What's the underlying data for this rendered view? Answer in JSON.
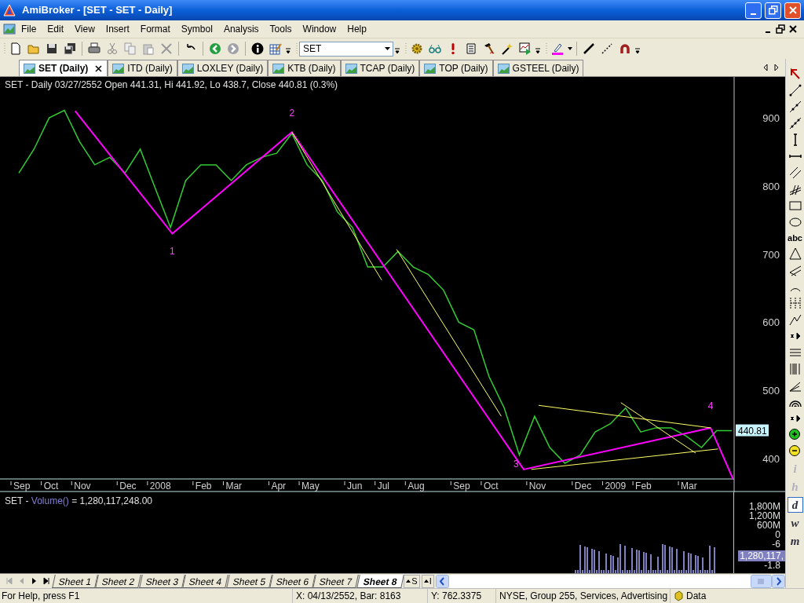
{
  "window": {
    "title": "AmiBroker - [SET - SET - Daily]"
  },
  "menu": [
    "File",
    "Edit",
    "View",
    "Insert",
    "Format",
    "Symbol",
    "Analysis",
    "Tools",
    "Window",
    "Help"
  ],
  "toolbar": {
    "symbol": "SET"
  },
  "chart_tabs": [
    {
      "label": "SET (Daily)",
      "selected": true
    },
    {
      "label": "ITD (Daily)",
      "selected": false
    },
    {
      "label": "LOXLEY (Daily)",
      "selected": false
    },
    {
      "label": "KTB (Daily)",
      "selected": false
    },
    {
      "label": "TCAP (Daily)",
      "selected": false
    },
    {
      "label": "TOP (Daily)",
      "selected": false
    },
    {
      "label": "GSTEEL (Daily)",
      "selected": false
    }
  ],
  "price_pane": {
    "header": "SET - Daily 03/27/2552 Open 441.31, Hi 441.92, Lo 438.7, Close 440.81 (0.3%)",
    "last_price": "440.81",
    "chart_data": {
      "type": "line",
      "categories": [
        "Sep",
        null,
        "Oct",
        null,
        "Nov",
        null,
        null,
        "Dec",
        null,
        "2008",
        null,
        null,
        "Feb",
        null,
        "Mar",
        null,
        null,
        "Apr",
        null,
        "May",
        null,
        null,
        "Jun",
        null,
        "Jul",
        null,
        "Aug",
        null,
        null,
        "Sep",
        null,
        "Oct",
        null,
        null,
        "Nov",
        null,
        null,
        "Dec",
        null,
        "2009",
        null,
        "Feb",
        null,
        null,
        "Mar",
        null,
        null,
        null
      ],
      "ylim": [
        370,
        960
      ],
      "yticks": [
        400,
        500,
        600,
        700,
        800,
        900
      ],
      "series": [
        {
          "color": "#33cc33",
          "values": [
            819,
            854,
            900,
            911,
            865,
            831,
            842,
            819,
            854,
            796,
            739,
            808,
            831,
            831,
            808,
            831,
            842,
            848,
            877,
            831,
            808,
            762,
            739,
            681,
            681,
            704,
            681,
            670,
            647,
            600,
            589,
            520,
            474,
            405,
            462,
            416,
            393,
            405,
            439,
            451,
            474,
            439,
            445,
            445,
            433,
            416,
            441,
            441
          ]
        }
      ]
    },
    "wave_labels": [
      "1",
      "2",
      "3",
      "4"
    ]
  },
  "volume_pane": {
    "symbol": "SET - ",
    "formula": "Volume()",
    "value": " = 1,280,117,248.00",
    "axis_labels": [
      "1,800M",
      "1,200M",
      "600M",
      "0",
      "-6"
    ],
    "last_value": "1,280,117,",
    "lower_label": "-1.8"
  },
  "drawing_tools": {
    "text_tool": "abc"
  },
  "intervals": [
    {
      "label": "i",
      "disabled": true,
      "selected": false
    },
    {
      "label": "h",
      "disabled": true,
      "selected": false
    },
    {
      "label": "d",
      "disabled": false,
      "selected": true
    },
    {
      "label": "w",
      "disabled": false,
      "selected": false
    },
    {
      "label": "m",
      "disabled": false,
      "selected": false
    }
  ],
  "sheets": [
    {
      "label": "Sheet 1",
      "selected": false
    },
    {
      "label": "Sheet 2",
      "selected": false
    },
    {
      "label": "Sheet 3",
      "selected": false
    },
    {
      "label": "Sheet 4",
      "selected": false
    },
    {
      "label": "Sheet 5",
      "selected": false
    },
    {
      "label": "Sheet 6",
      "selected": false
    },
    {
      "label": "Sheet 7",
      "selected": false
    },
    {
      "label": "Sheet 8",
      "selected": true
    }
  ],
  "pane_buttons": [
    "S",
    "I"
  ],
  "status_bar": {
    "help": "For Help, press F1",
    "x": "X: 04/13/2552, Bar: 8163",
    "y": "Y: 762.3375",
    "info": "NYSE, Group 255, Services, Advertising",
    "data": "Data"
  }
}
